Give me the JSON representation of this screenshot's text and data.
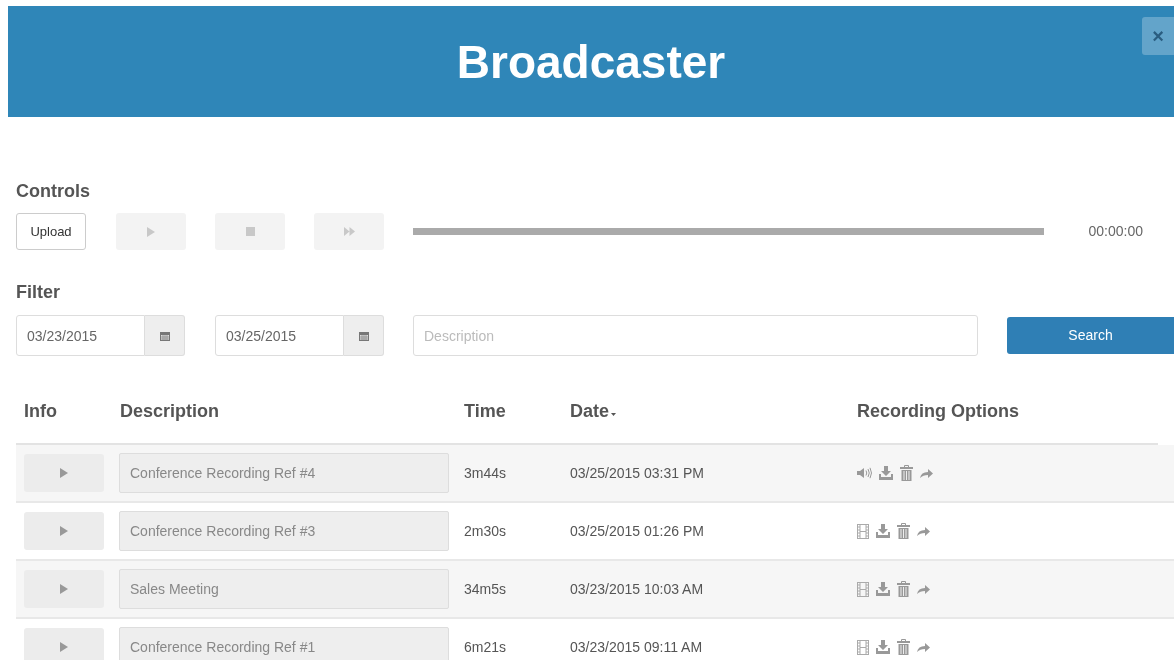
{
  "header": {
    "title": "Broadcaster",
    "close": "×"
  },
  "controls": {
    "heading": "Controls",
    "upload": "Upload",
    "time": "00:00:00"
  },
  "filter": {
    "heading": "Filter",
    "from": "03/23/2015",
    "to": "03/25/2015",
    "description_placeholder": "Description",
    "search": "Search"
  },
  "table": {
    "columns": [
      "Info",
      "Description",
      "Time",
      "Date",
      "Recording Options"
    ],
    "rows": [
      {
        "description": "Conference Recording Ref #4",
        "time": "3m44s",
        "date": "03/25/2015 03:31 PM",
        "kind": "audio"
      },
      {
        "description": "Conference Recording Ref #3",
        "time": "2m30s",
        "date": "03/25/2015 01:26 PM",
        "kind": "video"
      },
      {
        "description": "Sales Meeting",
        "time": "34m5s",
        "date": "03/23/2015 10:03 AM",
        "kind": "video"
      },
      {
        "description": "Conference Recording Ref #1",
        "time": "6m21s",
        "date": "03/23/2015 09:11 AM",
        "kind": "video"
      }
    ]
  }
}
